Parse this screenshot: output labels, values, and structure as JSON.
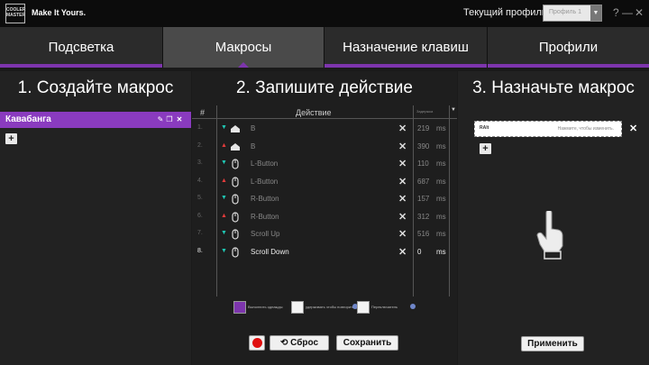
{
  "header": {
    "logo_text": "COOLER MASTER",
    "brand_slogan": "Make It Yours.",
    "profile_label": "Текущий профиль",
    "profile_value": "Профиль 1",
    "help_glyph": "?",
    "minimize_glyph": "—",
    "close_glyph": "✕"
  },
  "tabs": [
    {
      "label": "Подсветка",
      "active": false
    },
    {
      "label": "Макросы",
      "active": true
    },
    {
      "label": "Назначение клавиш",
      "active": false
    },
    {
      "label": "Профили",
      "active": false
    }
  ],
  "accent_color": "#7d35ad",
  "panel1": {
    "title": "1. Создайте макрос",
    "macros": [
      {
        "name": "Кавабанга"
      }
    ],
    "item_icons": [
      "edit-icon",
      "copy-icon",
      "delete-icon"
    ],
    "add_glyph": "+"
  },
  "panel2": {
    "title": "2. Запишите действие",
    "col_num": "#",
    "col_action": "Действие",
    "col_delay": "Задержка",
    "rows": [
      {
        "num": "1.",
        "dir": "down",
        "icon": "keyboard-key-icon",
        "action": "B",
        "time": "219",
        "unit": "ms"
      },
      {
        "num": "2.",
        "dir": "up",
        "icon": "keyboard-key-icon",
        "action": "B",
        "time": "390",
        "unit": "ms"
      },
      {
        "num": "3.",
        "dir": "down",
        "icon": "mouse-icon",
        "action": "L-Button",
        "time": "110",
        "unit": "ms"
      },
      {
        "num": "4.",
        "dir": "up",
        "icon": "mouse-icon",
        "action": "L-Button",
        "time": "687",
        "unit": "ms"
      },
      {
        "num": "5.",
        "dir": "down",
        "icon": "mouse-icon",
        "action": "R-Button",
        "time": "157",
        "unit": "ms"
      },
      {
        "num": "6.",
        "dir": "up",
        "icon": "mouse-icon",
        "action": "R-Button",
        "time": "312",
        "unit": "ms"
      },
      {
        "num": "7.",
        "dir": "down",
        "icon": "mouse-icon",
        "action": "Scroll Up",
        "time": "516",
        "unit": "ms"
      },
      {
        "num": "8.",
        "dir": "down",
        "icon": "mouse-icon",
        "action": "Scroll Down",
        "time": "0",
        "unit": "ms"
      }
    ],
    "options": [
      {
        "label": "Выполнить однажды",
        "checked": true
      },
      {
        "label": "удерживать чтобы повторить",
        "checked": false
      },
      {
        "label": "Переключатель",
        "checked": false
      }
    ],
    "reset_label": "Сброс",
    "save_label": "Сохранить"
  },
  "panel3": {
    "title": "3. Назначьте макрос",
    "key_value": "RAlt",
    "key_hint": "Нажмите, чтобы изменить.",
    "add_glyph": "+",
    "apply_label": "Применить"
  }
}
